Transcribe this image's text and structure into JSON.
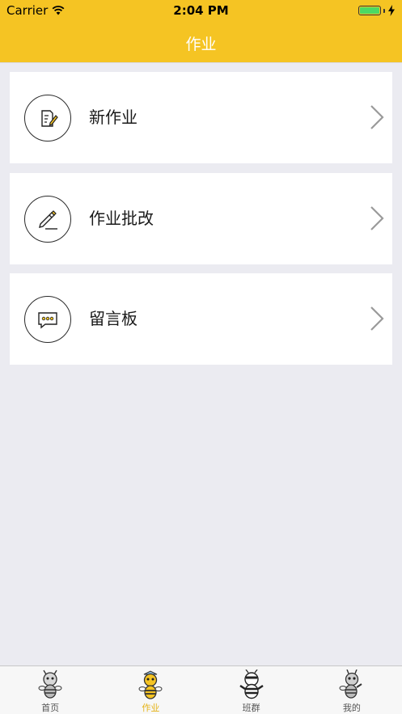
{
  "status_bar": {
    "carrier": "Carrier",
    "time": "2:04 PM",
    "battery_level": 1.0
  },
  "nav": {
    "title": "作业"
  },
  "menu": [
    {
      "label": "新作业",
      "icon": "homework-edit-icon"
    },
    {
      "label": "作业批改",
      "icon": "pencil-icon"
    },
    {
      "label": "留言板",
      "icon": "message-icon"
    }
  ],
  "tabbar": {
    "active_index": 1,
    "tabs": [
      {
        "label": "首页",
        "icon": "bee-home-icon"
      },
      {
        "label": "作业",
        "icon": "bee-homework-icon"
      },
      {
        "label": "班群",
        "icon": "bee-class-icon"
      },
      {
        "label": "我的",
        "icon": "bee-profile-icon"
      }
    ]
  },
  "colors": {
    "header": "#f5c423",
    "background": "#ebebf1",
    "active_tab": "#e5b317"
  }
}
